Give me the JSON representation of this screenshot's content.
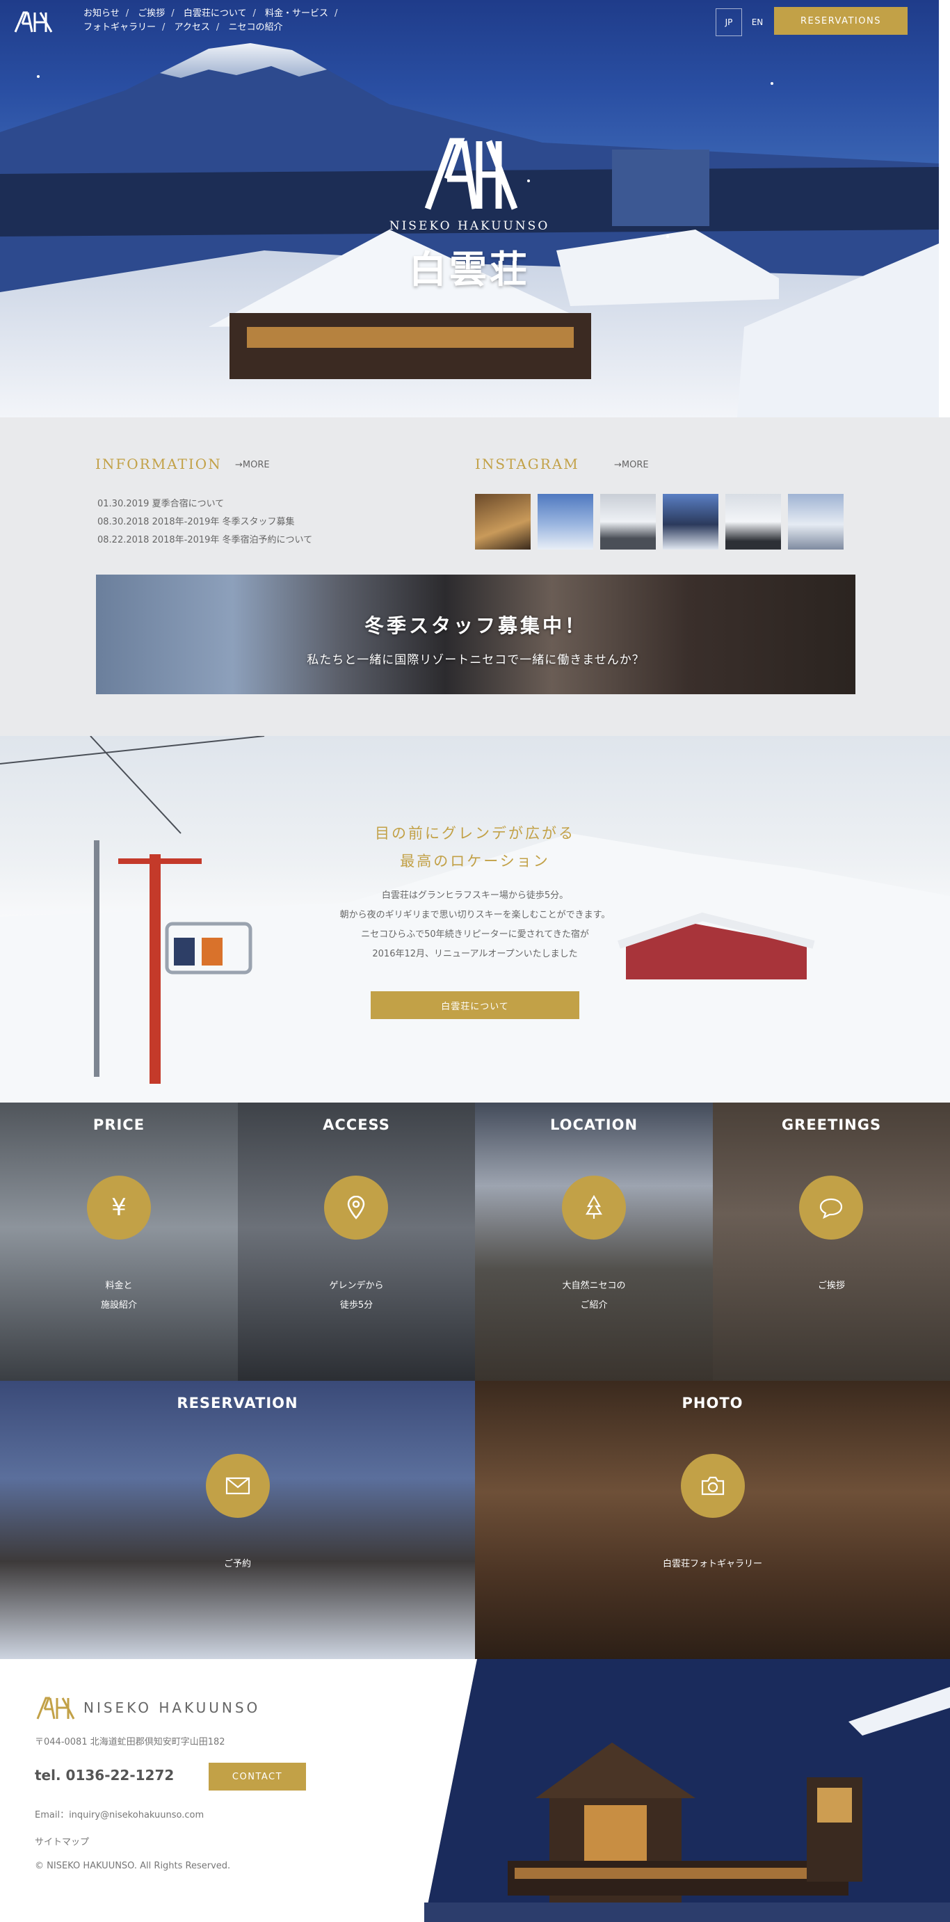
{
  "nav": {
    "items": [
      "お知らせ",
      "ご挨拶",
      "白雲荘について",
      "料金・サービス",
      "フォトギャラリー",
      "アクセス",
      "ニセコの紹介"
    ],
    "separator": "/",
    "lang_jp": "JP",
    "lang_en": "EN",
    "reservations": "RESERVATIONS"
  },
  "hero": {
    "brand_en": "NISEKO HAKUUNSO",
    "brand_jp": "白雲荘"
  },
  "information": {
    "title": "INFORMATION",
    "more": "→MORE",
    "items": [
      "01.30.2019 夏季合宿について",
      "08.30.2018 2018年-2019年 冬季スタッフ募集",
      "08.22.2018 2018年-2019年 冬季宿泊予約について"
    ]
  },
  "instagram": {
    "title": "INSTAGRAM",
    "more": "→MORE"
  },
  "recruit_banner": {
    "title": "冬季スタッフ募集中！",
    "subtitle": "私たちと一緒に国際リゾートニセコで一緒に働きませんか？"
  },
  "about": {
    "heading_line1": "目の前にグレンデが広がる",
    "heading_line2": "最高のロケーション",
    "body": [
      "白雲荘はグランヒラフスキー場から徒歩5分。",
      "朝から夜のギリギリまで思い切りスキーを楽しむことができます。",
      "ニセコひらふで50年続きリピーターに愛されてきた宿が",
      "2016年12月、リニューアルオープンいたしました"
    ],
    "button": "白雲荘について"
  },
  "tiles": {
    "price": {
      "title": "PRICE",
      "icon": "yen-icon",
      "desc": [
        "料金と",
        "施設紹介"
      ]
    },
    "access": {
      "title": "ACCESS",
      "icon": "map-pin-icon",
      "desc": [
        "ゲレンデから",
        "徒歩5分"
      ]
    },
    "location": {
      "title": "LOCATION",
      "icon": "tree-icon",
      "desc": [
        "大自然ニセコの",
        "ご紹介"
      ]
    },
    "greetings": {
      "title": "GREETINGS",
      "icon": "speech-bubble-icon",
      "desc": [
        "ご挨拶"
      ]
    },
    "reservation": {
      "title": "RESERVATION",
      "icon": "envelope-icon",
      "desc": [
        "ご予約"
      ]
    },
    "photo": {
      "title": "PHOTO",
      "icon": "camera-icon",
      "desc": [
        "白雲荘フォトギャラリー"
      ]
    }
  },
  "footer": {
    "brand": "NISEKO HAKUUNSO",
    "address": "〒044-0081 北海道虻田郡倶知安町字山田182",
    "tel": "tel. 0136-22-1272",
    "contact": "CONTACT",
    "email": "Email：inquiry@nisekohakuunso.com",
    "sitemap": "サイトマップ",
    "copyright": "© NISEKO HAKUUNSO. All Rights Reserved."
  },
  "colors": {
    "gold": "#c2a147",
    "gray_bg": "#e9eaec"
  }
}
